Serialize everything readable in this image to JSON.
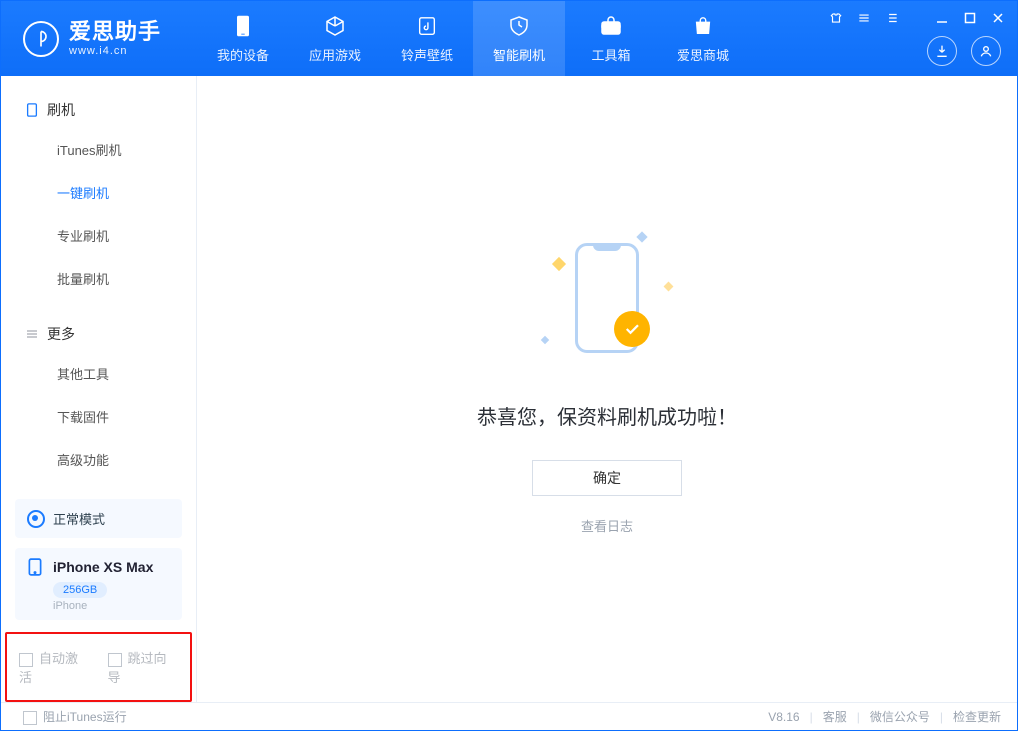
{
  "app": {
    "name": "爱思助手",
    "url": "www.i4.cn"
  },
  "topnav": {
    "items": [
      {
        "label": "我的设备",
        "icon": "device"
      },
      {
        "label": "应用游戏",
        "icon": "cube"
      },
      {
        "label": "铃声壁纸",
        "icon": "music"
      },
      {
        "label": "智能刷机",
        "icon": "shield"
      },
      {
        "label": "工具箱",
        "icon": "toolbox"
      },
      {
        "label": "爱思商城",
        "icon": "bag"
      }
    ],
    "active_index": 3
  },
  "sidebar": {
    "category1": {
      "label": "刷机"
    },
    "items1": [
      {
        "label": "iTunes刷机"
      },
      {
        "label": "一键刷机"
      },
      {
        "label": "专业刷机"
      },
      {
        "label": "批量刷机"
      }
    ],
    "active1": 1,
    "category2": {
      "label": "更多"
    },
    "items2": [
      {
        "label": "其他工具"
      },
      {
        "label": "下载固件"
      },
      {
        "label": "高级功能"
      }
    ]
  },
  "status": {
    "mode": "正常模式"
  },
  "device": {
    "name": "iPhone XS Max",
    "storage": "256GB",
    "type": "iPhone"
  },
  "options": {
    "auto_activate": "自动激活",
    "skip_guide": "跳过向导"
  },
  "main": {
    "headline": "恭喜您，保资料刷机成功啦！",
    "ok": "确定",
    "view_log": "查看日志"
  },
  "footer": {
    "block_itunes": "阻止iTunes运行",
    "version": "V8.16",
    "support": "客服",
    "wechat": "微信公众号",
    "update": "检查更新"
  }
}
